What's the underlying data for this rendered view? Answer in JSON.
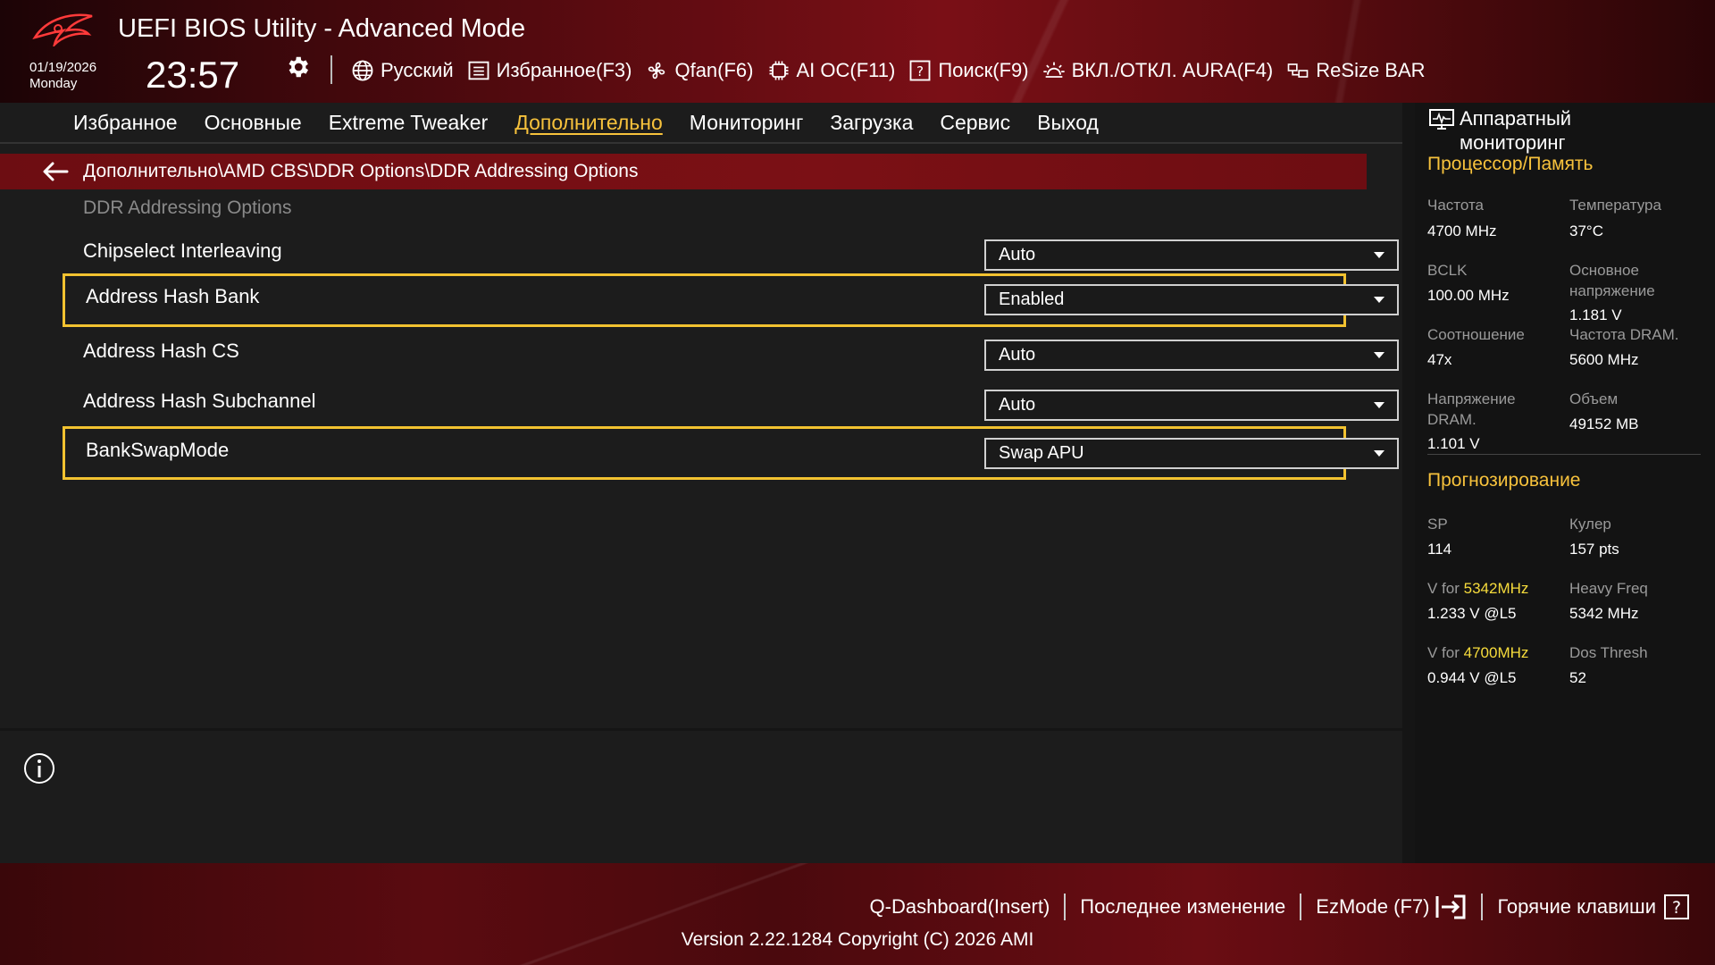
{
  "header": {
    "title": "UEFI BIOS Utility - Advanced Mode",
    "date": "01/19/2026",
    "day": "Monday",
    "time": "23:57",
    "toolbar": [
      {
        "label": "Русский",
        "icon": "globe-icon"
      },
      {
        "label": "Избранное(F3)",
        "icon": "favorites-icon"
      },
      {
        "label": "Qfan(F6)",
        "icon": "fan-icon"
      },
      {
        "label": "AI OC(F11)",
        "icon": "ai-chip-icon"
      },
      {
        "label": "Поиск(F9)",
        "icon": "help-search-icon"
      },
      {
        "label": "ВКЛ./ОТКЛ. AURA(F4)",
        "icon": "aura-light-icon"
      },
      {
        "label": "ReSize BAR",
        "icon": "resize-bar-icon"
      }
    ]
  },
  "nav": {
    "items": [
      "Избранное",
      "Основные",
      "Extreme Tweaker",
      "Дополнительно",
      "Мониторинг",
      "Загрузка",
      "Сервис",
      "Выход"
    ],
    "active_index": 3
  },
  "breadcrumb": "Дополнительно\\AMD CBS\\DDR Options\\DDR Addressing Options",
  "section_title": "DDR Addressing Options",
  "settings": [
    {
      "label": "Chipselect Interleaving",
      "value": "Auto",
      "highlighted": false
    },
    {
      "label": "Address Hash Bank",
      "value": "Enabled",
      "highlighted": true
    },
    {
      "label": "Address Hash CS",
      "value": "Auto",
      "highlighted": false
    },
    {
      "label": "Address Hash Subchannel",
      "value": "Auto",
      "highlighted": false
    },
    {
      "label": "BankSwapMode",
      "value": "Swap APU",
      "highlighted": true
    }
  ],
  "monitor": {
    "title": "Аппаратный мониторинг",
    "subtitle": "Процессор/Память",
    "freq_label": "Частота",
    "freq_value": "4700 MHz",
    "temp_label": "Температура",
    "temp_value": "37°C",
    "bclk_label": "BCLK",
    "bclk_value": "100.00 MHz",
    "core_v_label": "Основное напряжение",
    "core_v_value": "1.181 V",
    "ratio_label": "Соотношение",
    "ratio_value": "47x",
    "dram_freq_label": "Частота DRAM.",
    "dram_freq_value": "5600 MHz",
    "dram_v_label": "Напряжение DRAM.",
    "dram_v_value": "1.101 V",
    "capacity_label": "Объем",
    "capacity_value": "49152 MB",
    "prediction_title": "Прогнозирование",
    "sp_label": "SP",
    "sp_value": "114",
    "cooler_label": "Кулер",
    "cooler_value": "157 pts",
    "v1_prefix": "V for ",
    "v1_freq": "5342MHz",
    "v1_value": "1.233 V @L5",
    "heavy_label": "Heavy Freq",
    "heavy_value": "5342 MHz",
    "v2_prefix": "V for ",
    "v2_freq": "4700MHz",
    "v2_value": "0.944 V @L5",
    "dos_label": "Dos Thresh",
    "dos_value": "52"
  },
  "footer": {
    "qdash": "Q-Dashboard(Insert)",
    "last_change": "Последнее изменение",
    "ezmode": "EzMode (F7)",
    "hotkeys": "Горячие клавиши",
    "version": "Version 2.22.1284 Copyright (C) 2026 AMI"
  },
  "colors": {
    "accent": "#f7c23c",
    "highlight_border": "#f2c230",
    "breadcrumb_bg": "#7b1015"
  }
}
